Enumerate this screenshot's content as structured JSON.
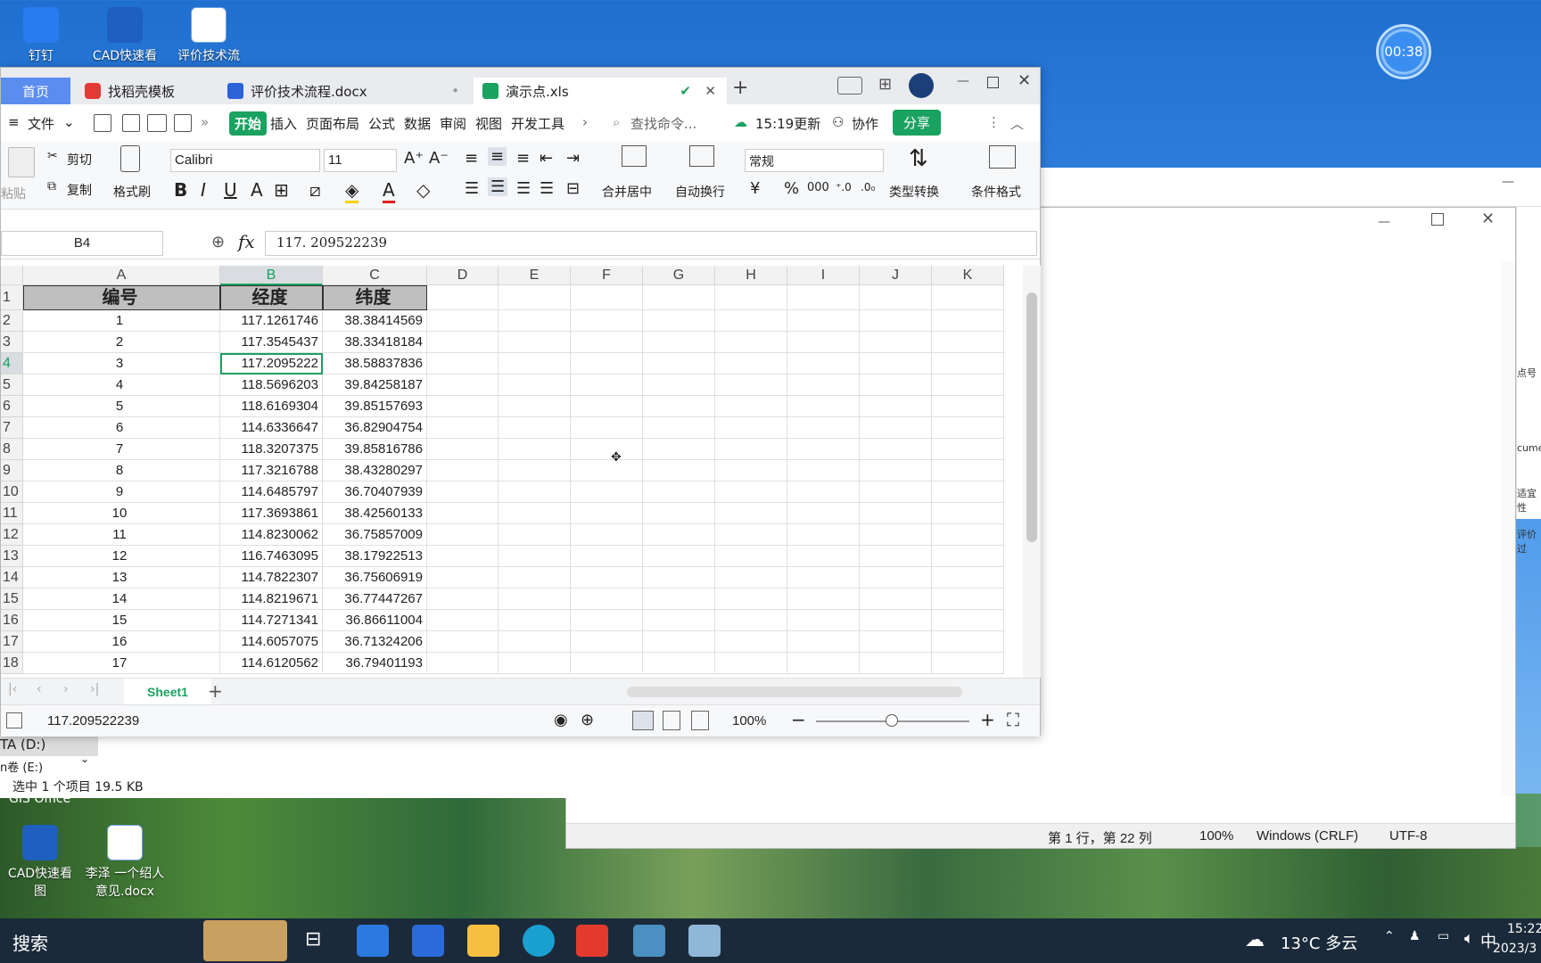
{
  "desktop": {
    "icons_top": [
      {
        "label": "钉钉"
      },
      {
        "label": "CAD快速看"
      },
      {
        "label": "评价技术流"
      }
    ],
    "icons_bottom": [
      {
        "label": "CAD快速看图"
      },
      {
        "label": "李泽 一个绍人意见.docx"
      }
    ],
    "timer": "00:38",
    "gis_label": "GIS Office"
  },
  "explorer": {
    "drive": "TA (D:)",
    "drive2": "n卷 (E:)",
    "selection": "选中 1 个项目  19.5 KB"
  },
  "notepad": {
    "position": "第 1 行，第 22 列",
    "zoom": "100%",
    "eol": "Windows (CRLF)",
    "encoding": "UTF-8",
    "side_text": [
      "点号",
      "cume",
      "适宜性",
      "评价过"
    ]
  },
  "wps": {
    "tabs": [
      {
        "label": "首页"
      },
      {
        "label": "找稻壳模板"
      },
      {
        "label": "评价技术流程.docx"
      },
      {
        "label": "演示点.xls"
      }
    ],
    "menu": {
      "file": "文件",
      "items": [
        "开始",
        "插入",
        "页面布局",
        "公式",
        "数据",
        "审阅",
        "视图",
        "开发工具"
      ],
      "search": "查找命令...",
      "update": "15:19更新",
      "collab": "协作",
      "share": "分享"
    },
    "ribbon": {
      "paste": "粘贴",
      "cut": "剪切",
      "copy": "复制",
      "format_painter": "格式刷",
      "font": "Calibri",
      "size": "11",
      "merge": "合并居中",
      "wrap": "自动换行",
      "number_format": "常规",
      "convert": "类型转换",
      "cond_format": "条件格式",
      "yen": "¥",
      "percent": "%",
      "thousands": "000"
    },
    "formula": {
      "cell_ref": "B4",
      "fx": "fx",
      "value": "117. 209522239"
    },
    "columns": [
      "A",
      "B",
      "C",
      "D",
      "E",
      "F",
      "G",
      "H",
      "I",
      "J",
      "K"
    ],
    "header_row": {
      "a": "编号",
      "b": "经度",
      "c": "纬度"
    },
    "rows": [
      {
        "r": "2",
        "a": "1",
        "b": "117.1261746",
        "c": "38.38414569"
      },
      {
        "r": "3",
        "a": "2",
        "b": "117.3545437",
        "c": "38.33418184"
      },
      {
        "r": "4",
        "a": "3",
        "b": "117.2095222",
        "c": "38.58837836"
      },
      {
        "r": "5",
        "a": "4",
        "b": "118.5696203",
        "c": "39.84258187"
      },
      {
        "r": "6",
        "a": "5",
        "b": "118.6169304",
        "c": "39.85157693"
      },
      {
        "r": "7",
        "a": "6",
        "b": "114.6336647",
        "c": "36.82904754"
      },
      {
        "r": "8",
        "a": "7",
        "b": "118.3207375",
        "c": "39.85816786"
      },
      {
        "r": "9",
        "a": "8",
        "b": "117.3216788",
        "c": "38.43280297"
      },
      {
        "r": "10",
        "a": "9",
        "b": "114.6485797",
        "c": "36.70407939"
      },
      {
        "r": "11",
        "a": "10",
        "b": "117.3693861",
        "c": "38.42560133"
      },
      {
        "r": "12",
        "a": "11",
        "b": "114.8230062",
        "c": "36.75857009"
      },
      {
        "r": "13",
        "a": "12",
        "b": "116.7463095",
        "c": "38.17922513"
      },
      {
        "r": "14",
        "a": "13",
        "b": "114.7822307",
        "c": "36.75606919"
      },
      {
        "r": "15",
        "a": "14",
        "b": "114.8219671",
        "c": "36.77447267"
      },
      {
        "r": "16",
        "a": "15",
        "b": "114.7271341",
        "c": "36.86611004"
      },
      {
        "r": "17",
        "a": "16",
        "b": "114.6057075",
        "c": "36.71324206"
      },
      {
        "r": "18",
        "a": "17",
        "b": "114.6120562",
        "c": "36.79401193"
      }
    ],
    "row1_label": "1",
    "sheet": "Sheet1",
    "status_value": "117.209522239",
    "zoom": "100%"
  },
  "taskbar": {
    "search": "搜索",
    "weather": "13°C 多云",
    "ime": "中",
    "time": "15:22",
    "date": "2023/3"
  }
}
